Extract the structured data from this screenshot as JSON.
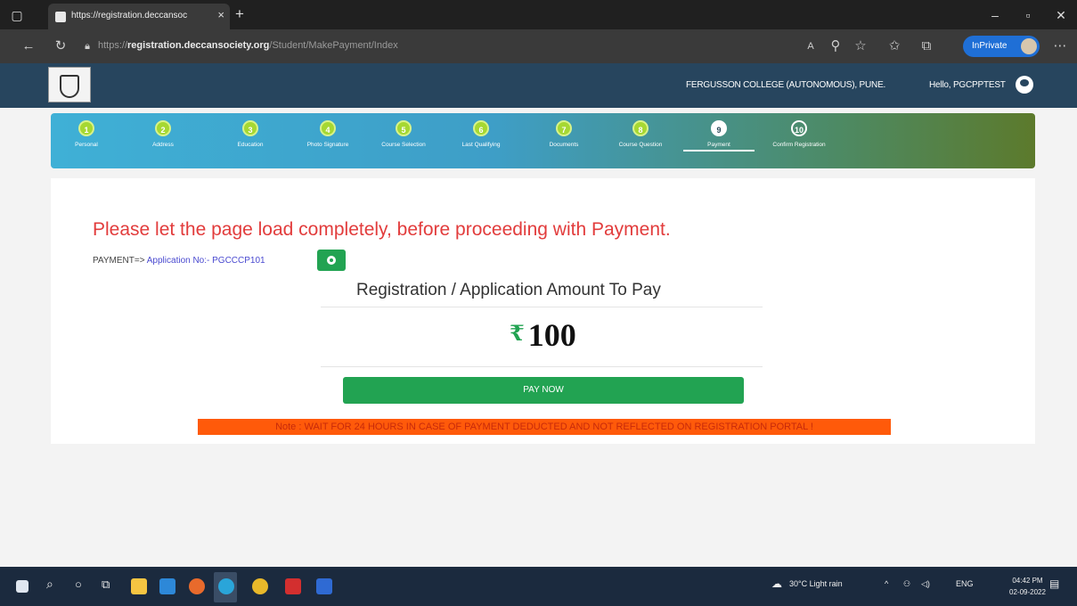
{
  "browser": {
    "tab_title": "https://registration.deccansoc",
    "close_tab": "×",
    "new_tab": "+",
    "url_prefix": "https://",
    "url_domain": "registration.deccansociety.org",
    "url_path": "/Student/MakePayment/Index",
    "inprivate_label": "InPrivate"
  },
  "header": {
    "college": "FERGUSSON COLLEGE (AUTONOMOUS), PUNE.",
    "greeting": "Hello, PGCPPTEST"
  },
  "steps": [
    {
      "num": "1",
      "label": "Personal"
    },
    {
      "num": "2",
      "label": "Address"
    },
    {
      "num": "3",
      "label": "Education"
    },
    {
      "num": "4",
      "label": "Photo Signature"
    },
    {
      "num": "5",
      "label": "Course Selection"
    },
    {
      "num": "6",
      "label": "Last Qualifying"
    },
    {
      "num": "7",
      "label": "Documents"
    },
    {
      "num": "8",
      "label": "Course Question"
    },
    {
      "num": "9",
      "label": "Payment"
    },
    {
      "num": "10",
      "label": "Confirm Registration"
    }
  ],
  "main": {
    "warning": "Please let the page load completely, before proceeding with Payment.",
    "payment_prefix": "PAYMENT=> ",
    "application_no": "Application No:- PGCCCP101",
    "amount_title": "Registration / Application Amount To Pay",
    "currency_symbol": "₹",
    "amount": "100",
    "pay_button": "PAY NOW",
    "note": "Note : WAIT FOR 24 HOURS IN CASE OF PAYMENT DEDUCTED AND NOT REFLECTED ON REGISTRATION PORTAL !"
  },
  "taskbar": {
    "weather": "30°C  Light rain",
    "language": "ENG",
    "time": "04:42 PM",
    "date": "02-09-2022"
  }
}
